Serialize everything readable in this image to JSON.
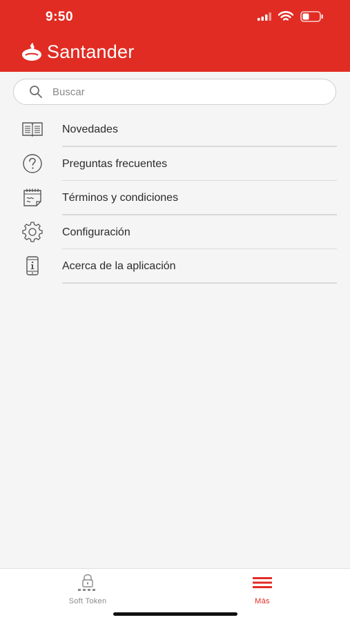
{
  "status_bar": {
    "time": "9:50"
  },
  "header": {
    "brand": "Santander",
    "brand_color": "#e12c23"
  },
  "search": {
    "placeholder": "Buscar"
  },
  "menu": {
    "items": [
      {
        "label": "Novedades",
        "icon": "book-icon"
      },
      {
        "label": "Preguntas frecuentes",
        "icon": "question-circle-icon"
      },
      {
        "label": "Términos y condiciones",
        "icon": "document-calendar-icon"
      },
      {
        "label": "Configuración",
        "icon": "gear-icon"
      },
      {
        "label": "Acerca de la aplicación",
        "icon": "phone-info-icon"
      }
    ]
  },
  "tabbar": {
    "items": [
      {
        "label": "Soft Token",
        "icon": "lock-token-icon",
        "active": false
      },
      {
        "label": "Más",
        "icon": "hamburger-menu-icon",
        "active": true
      }
    ]
  }
}
